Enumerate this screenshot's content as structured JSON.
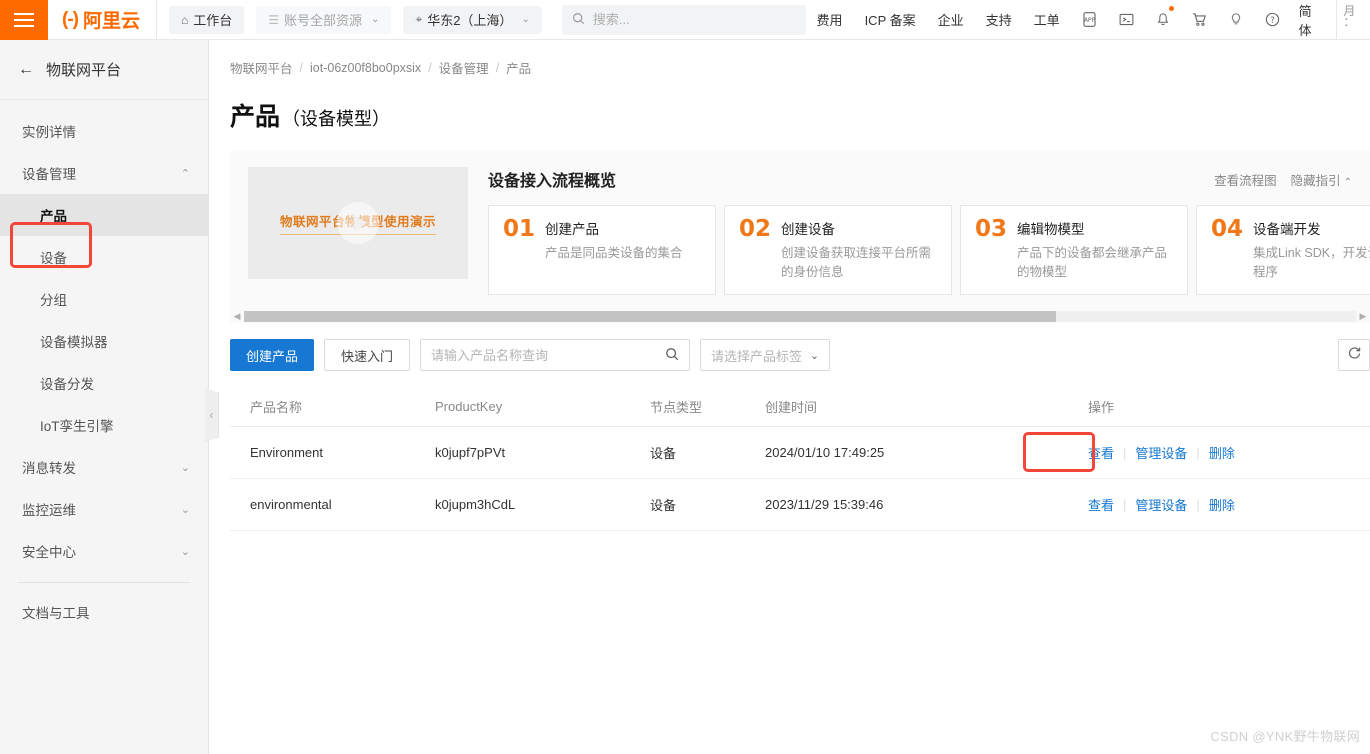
{
  "topbar": {
    "menu_icon": "hamburger-icon",
    "brand_mark": "(-)",
    "brand_name": "阿里云",
    "workbench": {
      "label": "工作台",
      "icon": "home-icon"
    },
    "resources": {
      "label": "账号全部资源",
      "icon": "list-icon",
      "caret": "⌄"
    },
    "region": {
      "label": "华东2（上海）",
      "icon": "location-icon",
      "caret": "⌄"
    },
    "search": {
      "placeholder": "搜索...",
      "value": "",
      "icon": "search-icon"
    },
    "links": [
      "费用",
      "ICP 备案",
      "企业",
      "支持",
      "工单"
    ],
    "icons": [
      {
        "name": "app-icon",
        "glyph": "APP"
      },
      {
        "name": "terminal-icon",
        "glyph": ">_"
      },
      {
        "name": "notification-bell-icon",
        "glyph": "bell",
        "has_dot": true
      },
      {
        "name": "shopping-cart-icon",
        "glyph": "cart"
      },
      {
        "name": "lightbulb-icon",
        "glyph": "bulb"
      },
      {
        "name": "help-icon",
        "glyph": "?"
      }
    ],
    "language": "简体"
  },
  "sidebar": {
    "header": {
      "back_icon": "arrow-left-icon",
      "title": "物联网平台"
    },
    "items": [
      {
        "label": "实例详情",
        "level": "top",
        "expandable": false,
        "active": false
      },
      {
        "label": "设备管理",
        "level": "top",
        "expandable": true,
        "caret": "⌃",
        "active": false
      },
      {
        "label": "产品",
        "level": "sub",
        "expandable": false,
        "active": true
      },
      {
        "label": "设备",
        "level": "sub",
        "expandable": false,
        "active": false
      },
      {
        "label": "分组",
        "level": "sub",
        "expandable": false,
        "active": false
      },
      {
        "label": "设备模拟器",
        "level": "sub",
        "expandable": false,
        "active": false
      },
      {
        "label": "设备分发",
        "level": "sub",
        "expandable": false,
        "active": false
      },
      {
        "label": "IoT孪生引擎",
        "level": "sub",
        "expandable": false,
        "active": false
      },
      {
        "label": "消息转发",
        "level": "top",
        "expandable": true,
        "caret": "⌄",
        "active": false
      },
      {
        "label": "监控运维",
        "level": "top",
        "expandable": true,
        "caret": "⌄",
        "active": false
      },
      {
        "label": "安全中心",
        "level": "top",
        "expandable": true,
        "caret": "⌄",
        "active": false
      }
    ],
    "footer_item": {
      "label": "文档与工具"
    },
    "collapse_handle": "‹"
  },
  "breadcrumb": {
    "items": [
      "物联网平台",
      "iot-06z00f8bo0pxsix",
      "设备管理",
      "产品"
    ],
    "separator": "/"
  },
  "page": {
    "title": "产品",
    "title_suffix": "（设备模型）"
  },
  "guide": {
    "video": {
      "caption": "物联网平台物模型使用演示",
      "play_icon": "play-icon"
    },
    "heading": "设备接入流程概览",
    "view_flow_link": "查看流程图",
    "hide_guide_link": "隐藏指引",
    "hide_guide_caret": "⌃",
    "steps": [
      {
        "num": "01",
        "title": "创建产品",
        "desc": "产品是同品类设备的集合"
      },
      {
        "num": "02",
        "title": "创建设备",
        "desc": "创建设备获取连接平台所需的身份信息"
      },
      {
        "num": "03",
        "title": "编辑物模型",
        "desc": "产品下的设备都会继承产品的物模型"
      },
      {
        "num": "04",
        "title": "设备端开发",
        "desc": "集成Link SDK，开发设备端程序"
      }
    ],
    "scrollbar": {
      "left_arrow": "◀",
      "right_arrow": "▶",
      "thumb_percent": 73
    }
  },
  "toolbar": {
    "create_product": "创建产品",
    "quick_start": "快速入门",
    "search": {
      "placeholder": "请输入产品名称查询",
      "value": "",
      "icon": "search-icon"
    },
    "tag_select": {
      "placeholder": "请选择产品标签",
      "caret": "⌄"
    },
    "refresh_icon": "refresh-icon"
  },
  "table": {
    "columns": [
      "产品名称",
      "ProductKey",
      "节点类型",
      "创建时间",
      "操作"
    ],
    "rows": [
      {
        "name": "Environment",
        "product_key": "k0jupf7pPVt",
        "node_type": "设备",
        "created_at": "2024/01/10 17:49:25",
        "ops": [
          "查看",
          "管理设备",
          "删除"
        ],
        "highlight_op": "查看"
      },
      {
        "name": "environmental",
        "product_key": "k0jupm3hCdL",
        "node_type": "设备",
        "created_at": "2023/11/29 15:39:46",
        "ops": [
          "查看",
          "管理设备",
          "删除"
        ],
        "highlight_op": ""
      }
    ]
  },
  "watermark": "CSDN @YNK野牛物联网",
  "colors": {
    "brand_orange": "#ff6a00",
    "primary_blue": "#1678d2",
    "link_blue": "#1678d2",
    "highlight_red": "#f4453a",
    "step_number": "#f07818"
  }
}
